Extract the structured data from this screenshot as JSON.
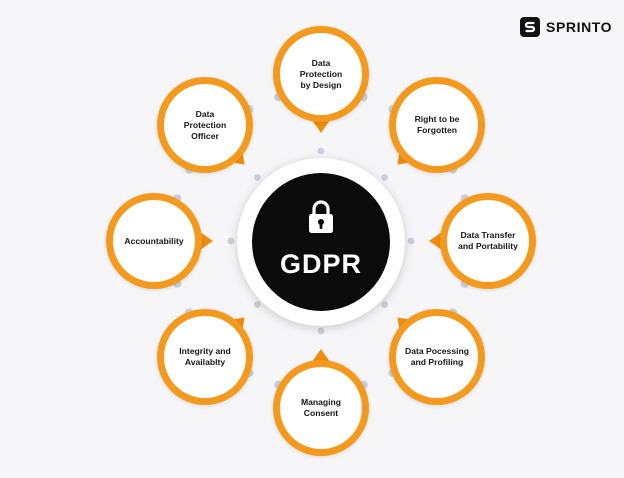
{
  "brand": {
    "name": "SPRINTO",
    "logo_icon": "sprinto-s-icon"
  },
  "hub": {
    "title": "GDPR",
    "icon": "padlock-icon"
  },
  "colors": {
    "accent": "#f39a1e",
    "pointer": "#f08c0f",
    "hub_bg": "#0b0b0b",
    "connector_dots": "#c9cfdc",
    "background": "#f6f6f8"
  },
  "nodes": [
    {
      "label": "Data\nProtection\nby Design"
    },
    {
      "label": "Right to be\nForgotten"
    },
    {
      "label": "Data Transfer\nand Portability"
    },
    {
      "label": "Data Pocessing\nand Profiling"
    },
    {
      "label": "Managing\nConsent"
    },
    {
      "label": "Integrity and\nAvailablty"
    },
    {
      "label": "Accountability"
    },
    {
      "label": "Data\nProtection\nOfficer"
    }
  ]
}
